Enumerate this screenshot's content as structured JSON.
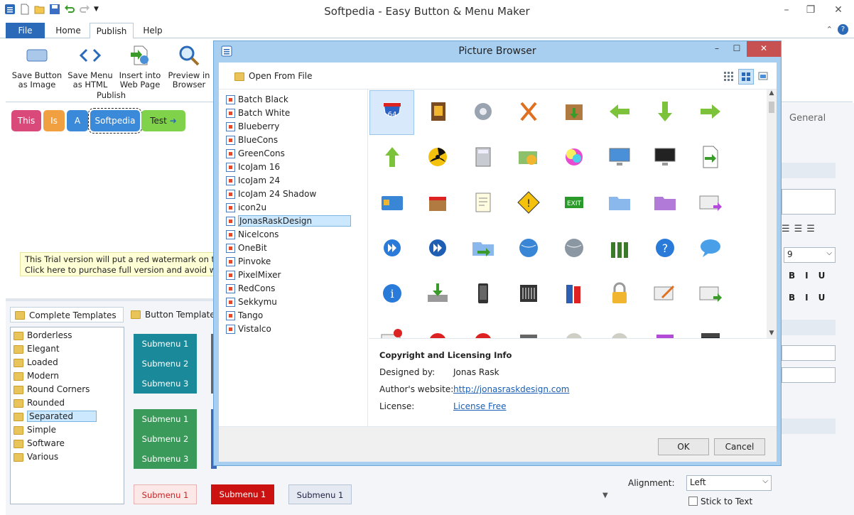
{
  "window": {
    "title": "Softpedia - Easy Button & Menu Maker"
  },
  "tabs": {
    "file": "File",
    "home": "Home",
    "publish": "Publish",
    "help": "Help"
  },
  "ribbon": {
    "group": "Publish",
    "buttons": [
      {
        "l1": "Save Button",
        "l2": "as Image"
      },
      {
        "l1": "Save Menu",
        "l2": "as HTML"
      },
      {
        "l1": "Insert into",
        "l2": "Web Page"
      },
      {
        "l1": "Preview in",
        "l2": "Browser"
      }
    ]
  },
  "menu_buttons": [
    "This",
    "Is",
    "A",
    "Softpedia",
    "Test"
  ],
  "trial": {
    "line1": "This Trial version will put a red watermark on the bu",
    "line2": "Click here to purchase full version and avoid waterm"
  },
  "templates": {
    "tabs": [
      "Complete Templates",
      "Button Templates"
    ],
    "items": [
      "Borderless",
      "Elegant",
      "Loaded",
      "Modern",
      "Round Corners",
      "Rounded",
      "Separated",
      "Simple",
      "Software",
      "Various"
    ],
    "selected": "Separated",
    "submenus": [
      "Submenu 1",
      "Submenu 2",
      "Submenu 3"
    ]
  },
  "right_panel": {
    "tab": "General",
    "font_size": "9",
    "alignment_label": "Alignment:",
    "alignment_value": "Left",
    "stick": "Stick to Text"
  },
  "dialog": {
    "title": "Picture Browser",
    "open_from_file": "Open From File",
    "sets": [
      "Batch Black",
      "Batch White",
      "Blueberry",
      "BlueCons",
      "GreenCons",
      "IcoJam 16",
      "IcoJam 24",
      "IcoJam 24 Shadow",
      "icon2u",
      "JonasRaskDesign",
      "Nicelcons",
      "OneBit",
      "Pinvoke",
      "PixelMixer",
      "RedCons",
      "Sekkymu",
      "Tango",
      "Vistalco"
    ],
    "selected_set": "JonasRaskDesign",
    "info": {
      "heading": "Copyright and Licensing Info",
      "designed_label": "Designed by:",
      "designed_value": "Jonas Rask",
      "website_label": "Author's website:",
      "website_value": "http://jonasraskdesign.com",
      "license_label": "License:",
      "license_value": "License Free"
    },
    "ok": "OK",
    "cancel": "Cancel"
  }
}
